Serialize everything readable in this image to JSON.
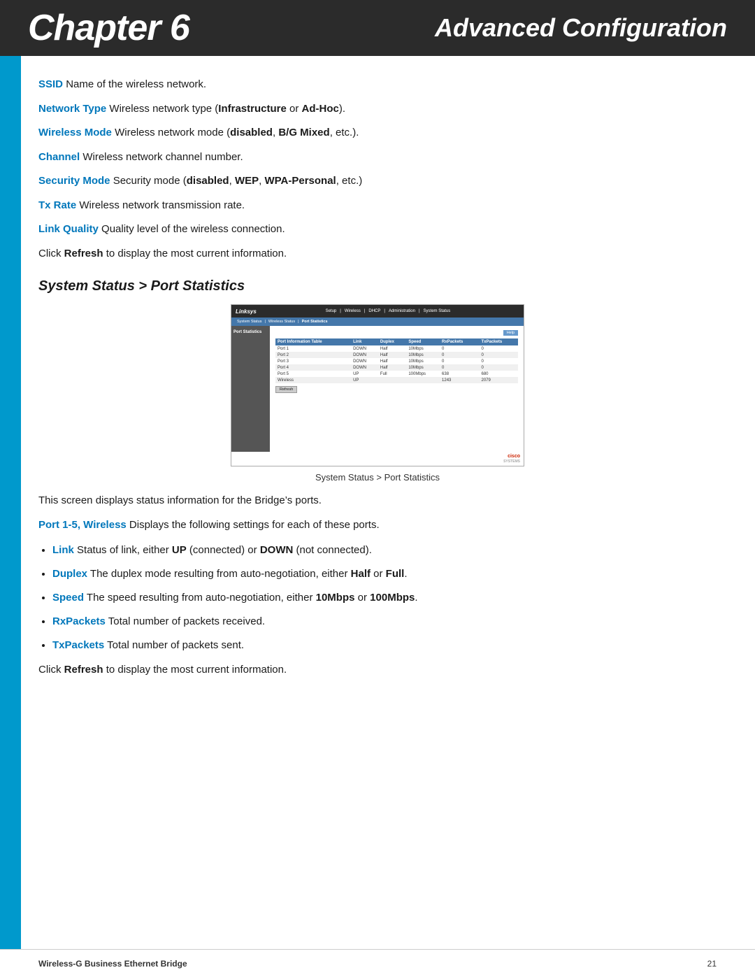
{
  "header": {
    "chapter_label": "Chapter 6",
    "chapter_display": "Chapter",
    "chapter_number": "6",
    "section_title": "Advanced Configuration"
  },
  "terms": [
    {
      "keyword": "SSID",
      "text": "  Name of the wireless network."
    },
    {
      "keyword": "Network Type",
      "text": "  Wireless network type (",
      "bold_parts": [
        "Infrastructure",
        "Ad-Hoc"
      ],
      "text2": " or ",
      "text3": ")."
    },
    {
      "keyword": "Wireless Mode",
      "text": "  Wireless network mode (",
      "bold_parts": [
        "disabled",
        "B/G Mixed"
      ],
      "text2": ", ",
      "text3": ", etc.)."
    },
    {
      "keyword": "Channel",
      "text": "  Wireless network channel number."
    },
    {
      "keyword": "Security Mode",
      "text": "  Security mode (",
      "bold_parts": [
        "disabled",
        "WEP",
        "WPA-Personal"
      ],
      "text2": ", ",
      "text3": ", etc.)"
    },
    {
      "keyword": "Tx Rate",
      "text": "  Wireless network transmission rate."
    },
    {
      "keyword": "Link Quality",
      "text": "  Quality level of the wireless connection."
    }
  ],
  "refresh_note": "Click ",
  "refresh_bold": "Refresh",
  "refresh_note2": " to display the most current information.",
  "section2": {
    "heading": "System Status > Port Statistics"
  },
  "screenshot": {
    "logo": "Linksys",
    "nav_items": [
      "Setup",
      "Wireless",
      "DHCP",
      "Administration",
      "System Status"
    ],
    "sub_items": [
      "System Status",
      "Wireless Status",
      "Port Statistics"
    ],
    "left_label": "Port Statistics",
    "help_btn": "Help",
    "table": {
      "headers": [
        "Port Information Table",
        "Link",
        "Duplex",
        "Speed",
        "RxPackets",
        "TxPackets"
      ],
      "rows": [
        [
          "Port 1",
          "DOWN",
          "Half",
          "10Mbps",
          "0",
          "0"
        ],
        [
          "Port 2",
          "DOWN",
          "Half",
          "10Mbps",
          "0",
          "0"
        ],
        [
          "Port 3",
          "DOWN",
          "Half",
          "10Mbps",
          "0",
          "0"
        ],
        [
          "Port 4",
          "DOWN",
          "Half",
          "10Mbps",
          "0",
          "0"
        ],
        [
          "Port 5",
          "UP",
          "Full",
          "100Mbps",
          "638",
          "680"
        ],
        [
          "Wireless",
          "UP",
          "",
          "",
          "1243",
          "2079"
        ]
      ]
    },
    "refresh_btn": "Refresh",
    "cisco_logo": "cisco"
  },
  "caption": "System Status > Port Statistics",
  "body_para1": "This screen displays status information for the Bridge’s ports.",
  "port_term": {
    "keyword": "Port 1-5, Wireless",
    "text": "  Displays the following settings for each of these ports."
  },
  "bullet_items": [
    {
      "keyword": "Link",
      "text": "  Status of link, either ",
      "bold1": "UP",
      "text2": " (connected) or ",
      "bold2": "DOWN",
      "text3": " (not connected)."
    },
    {
      "keyword": "Duplex",
      "text": "  The duplex mode resulting from auto-negotiation, either ",
      "bold1": "Half",
      "text2": " or ",
      "bold2": "Full",
      "text3": "."
    },
    {
      "keyword": "Speed",
      "text": "  The speed resulting from auto-negotiation, either ",
      "bold1": "10Mbps",
      "text2": " or ",
      "bold2": "100Mbps",
      "text3": "."
    },
    {
      "keyword": "RxPackets",
      "text": "  Total number of packets received."
    },
    {
      "keyword": "TxPackets",
      "text": "  Total number of packets sent."
    }
  ],
  "refresh_note_bottom": "Click ",
  "refresh_bold_bottom": "Refresh",
  "refresh_note2_bottom": " to display the most current information.",
  "footer": {
    "product": "Wireless-G Business Ethernet Bridge",
    "page_number": "21"
  }
}
